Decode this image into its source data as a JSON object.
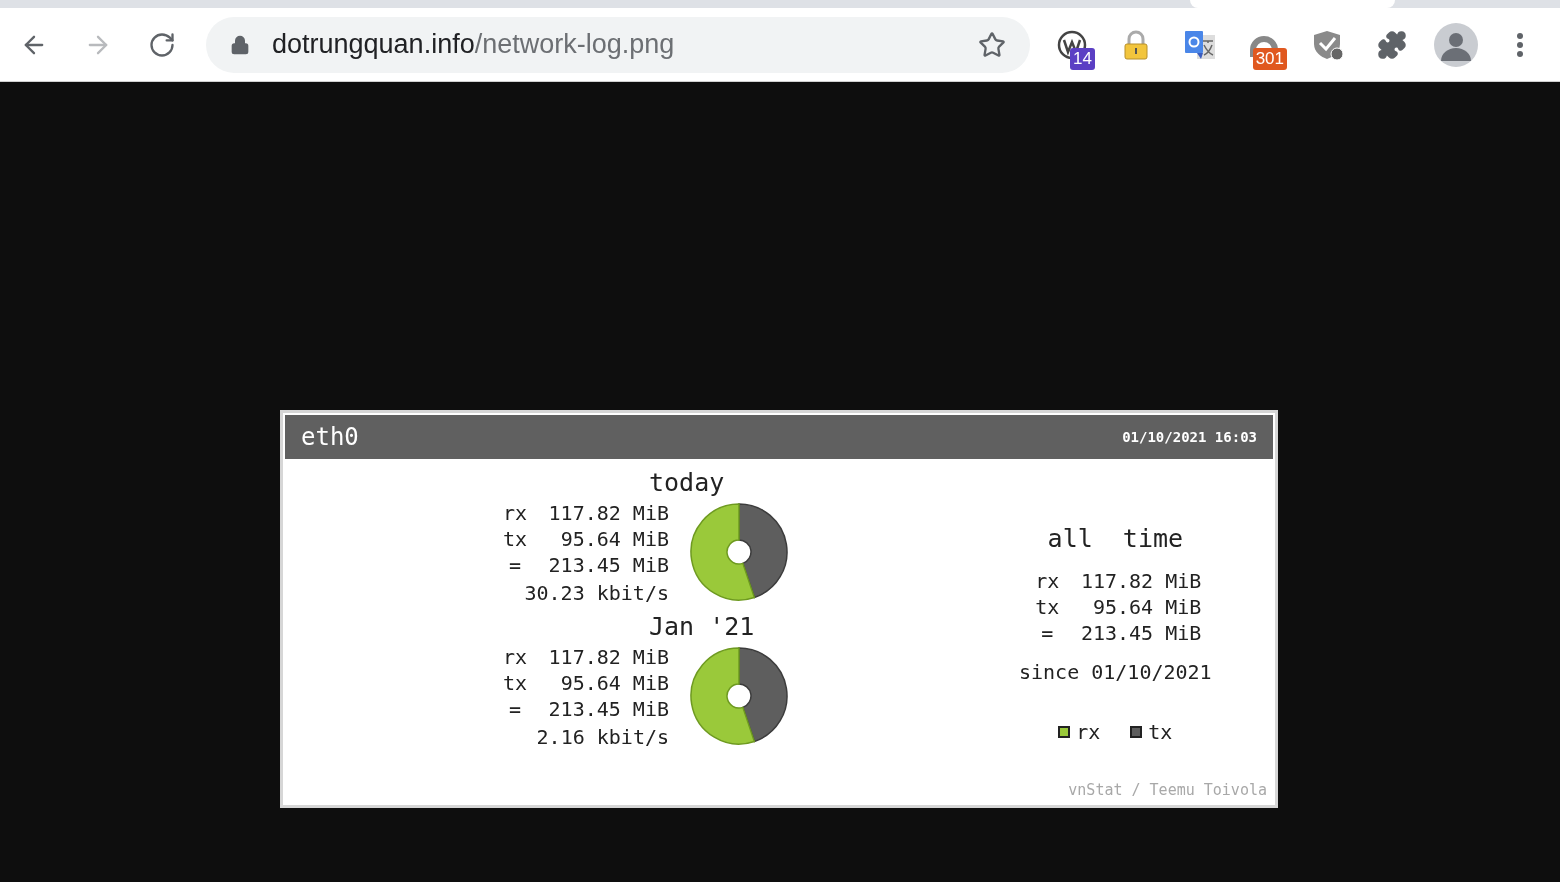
{
  "browser": {
    "address": {
      "domain": "dotrungquan.info",
      "path": "/network-log.png"
    },
    "extensions": [
      {
        "kind": "wordpress",
        "badge": "14",
        "color": "#5b3fc4"
      },
      {
        "kind": "padlock"
      },
      {
        "kind": "translate"
      },
      {
        "kind": "arch",
        "badge": "301",
        "color": "#e0581f"
      },
      {
        "kind": "shield"
      },
      {
        "kind": "puzzle"
      },
      {
        "kind": "avatar"
      },
      {
        "kind": "menu"
      }
    ]
  },
  "vnstat": {
    "interface": "eth0",
    "timestamp": "01/10/2021 16:03",
    "periods": [
      {
        "title": "today",
        "rows": [
          {
            "label": "rx",
            "value": "117.82 MiB"
          },
          {
            "label": "tx",
            "value": "95.64 MiB"
          },
          {
            "label": "=",
            "value": "213.45 MiB"
          }
        ],
        "rate": "30.23 kbit/s",
        "chart_data": {
          "type": "donut",
          "values": [
            44.81,
            55.19
          ]
        }
      },
      {
        "title": "Jan '21",
        "rows": [
          {
            "label": "rx",
            "value": "117.82 MiB"
          },
          {
            "label": "tx",
            "value": "95.64 MiB"
          },
          {
            "label": "=",
            "value": "213.45 MiB"
          }
        ],
        "rate": "2.16 kbit/s",
        "chart_data": {
          "type": "donut",
          "values": [
            44.81,
            55.19
          ]
        }
      }
    ],
    "all_time": {
      "title": "all  time",
      "rows": [
        {
          "label": "rx",
          "value": "117.82 MiB"
        },
        {
          "label": "tx",
          "value": "95.64 MiB"
        },
        {
          "label": "=",
          "value": "213.45 MiB"
        }
      ],
      "since": "since 01/10/2021"
    },
    "legend": [
      {
        "label": "rx",
        "color": "#9ac93a"
      },
      {
        "label": "tx",
        "color": "#5e5e5e"
      }
    ],
    "credit": "vnStat / Teemu Toivola"
  }
}
